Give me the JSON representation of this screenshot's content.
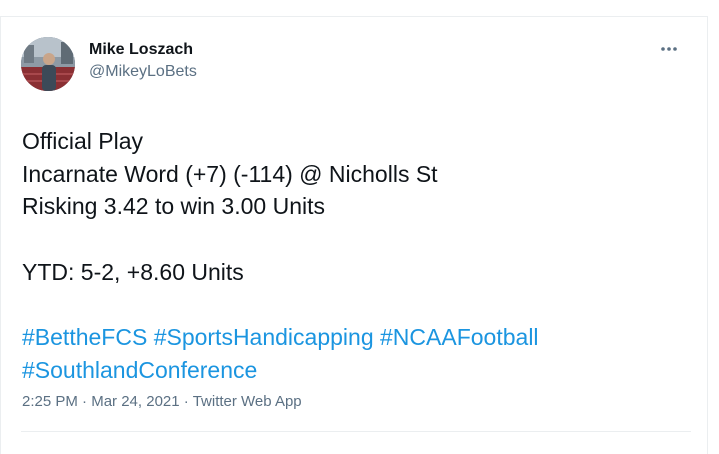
{
  "author": {
    "display_name": "Mike Loszach",
    "handle": "@MikeyLoBets"
  },
  "tweet": {
    "lines": [
      "Official Play",
      "Incarnate Word (+7) (-114) @ Nicholls St",
      "Risking 3.42 to win 3.00 Units"
    ],
    "ytd": "YTD: 5-2, +8.60 Units",
    "hashtags": [
      "#BettheFCS",
      "#SportsHandicapping",
      "#NCAAFootball",
      "#SouthlandConference"
    ]
  },
  "meta": {
    "time": "2:25 PM",
    "separator": "·",
    "date": "Mar 24, 2021",
    "source": "Twitter Web App"
  },
  "icons": {
    "more": "more-options-icon"
  },
  "colors": {
    "text_primary": "#0f1419",
    "text_secondary": "#5b7083",
    "link": "#1b95e0",
    "border": "#ebeef0"
  }
}
